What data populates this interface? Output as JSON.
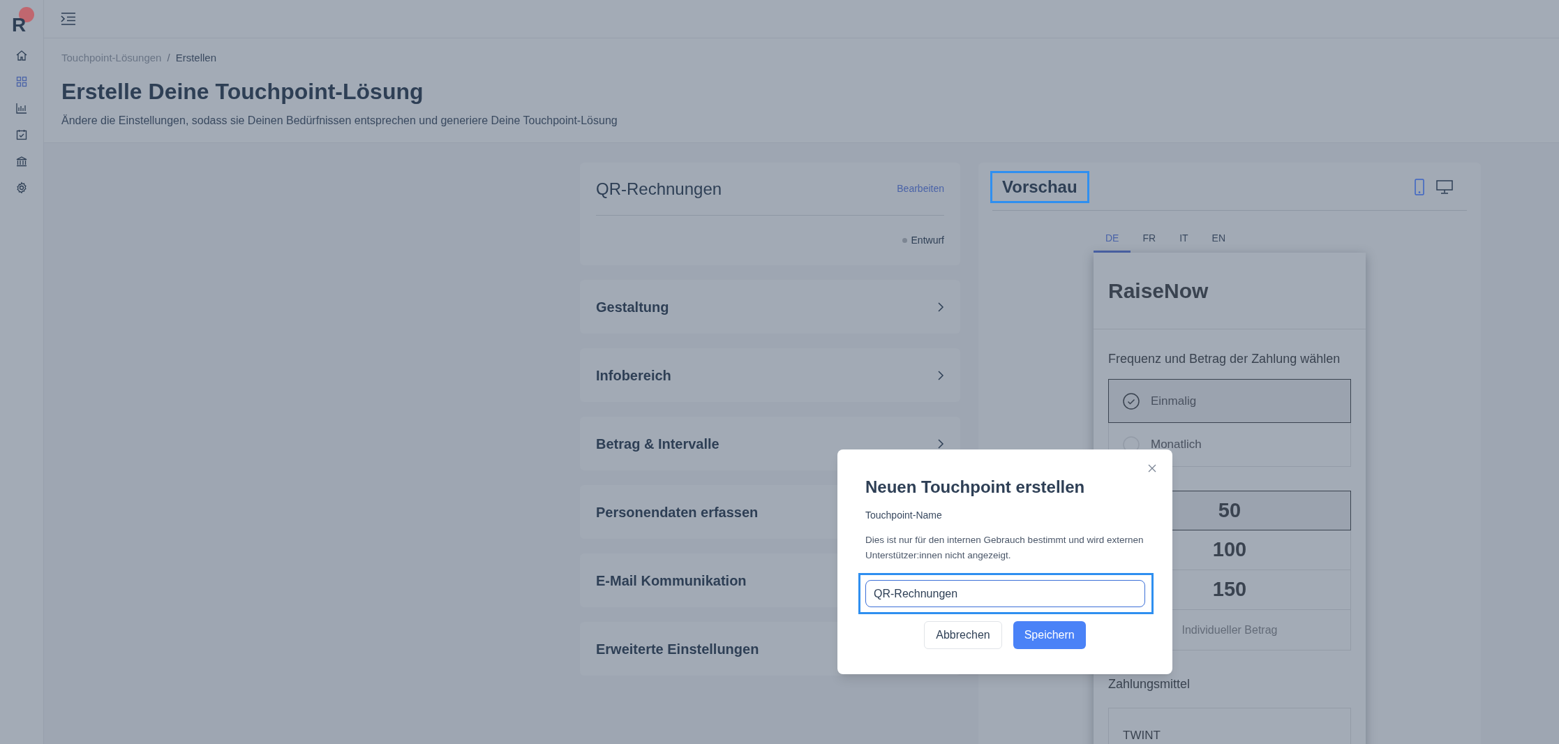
{
  "sidebar": {
    "logo": "R",
    "items": [
      {
        "kind": "home",
        "selected": false
      },
      {
        "kind": "grid",
        "selected": true
      },
      {
        "kind": "chart",
        "selected": false
      },
      {
        "kind": "calendar",
        "selected": false
      },
      {
        "kind": "bank",
        "selected": false
      },
      {
        "kind": "settings",
        "selected": false
      }
    ]
  },
  "breadcrumb": {
    "separator": "/",
    "items": [
      {
        "label": "Touchpoint-Lösungen",
        "current": false
      },
      {
        "label": "Erstellen",
        "current": true
      }
    ]
  },
  "page": {
    "title": "Erstelle Deine Touchpoint-Lösung",
    "subtitle": "Ändere die Einstellungen, sodass sie Deinen Bedürfnissen entsprechen und generiere Deine Touchpoint-Lösung"
  },
  "touchpoint_card": {
    "name": "QR-Rechnungen",
    "edit_link": "Bearbeiten",
    "status": "Entwurf"
  },
  "sections": [
    {
      "label": "Gestaltung"
    },
    {
      "label": "Infobereich"
    },
    {
      "label": "Betrag & Intervalle"
    },
    {
      "label": "Personendaten erfassen"
    },
    {
      "label": "E-Mail Kommunikation"
    },
    {
      "label": "Erweiterte Einstellungen"
    }
  ],
  "preview": {
    "title": "Vorschau",
    "highlighted": true,
    "devices": [
      {
        "kind": "mobile",
        "selected": true
      },
      {
        "kind": "desktop",
        "selected": false
      }
    ],
    "languages": [
      {
        "label": "DE",
        "selected": true
      },
      {
        "label": "FR",
        "selected": false
      },
      {
        "label": "IT",
        "selected": false
      },
      {
        "label": "EN",
        "selected": false
      }
    ],
    "form": {
      "brand": "RaiseNow",
      "frequency_heading": "Frequenz und Betrag der Zahlung wählen",
      "frequencies": [
        {
          "label": "Einmalig",
          "selected": true
        },
        {
          "label": "Monatlich",
          "selected": false
        }
      ],
      "amounts": [
        {
          "label": "50",
          "selected": true
        },
        {
          "label": "100",
          "selected": false
        },
        {
          "label": "150",
          "selected": false
        }
      ],
      "custom_amount_placeholder": "Individueller Betrag",
      "payment_heading": "Zahlungsmittel",
      "payment_methods": [
        {
          "label": "TWINT"
        }
      ]
    }
  },
  "dialog": {
    "title": "Neuen Touchpoint erstellen",
    "field_label": "Touchpoint-Name",
    "help": "Dies ist nur für den internen Gebrauch bestimmt und wird externen Unterstützer:innen nicht angezeigt.",
    "value": "QR-Rechnungen",
    "highlighted": true,
    "buttons": [
      {
        "label": "Abbrechen",
        "kind": "secondary"
      },
      {
        "label": "Speichern",
        "kind": "primary"
      }
    ]
  }
}
